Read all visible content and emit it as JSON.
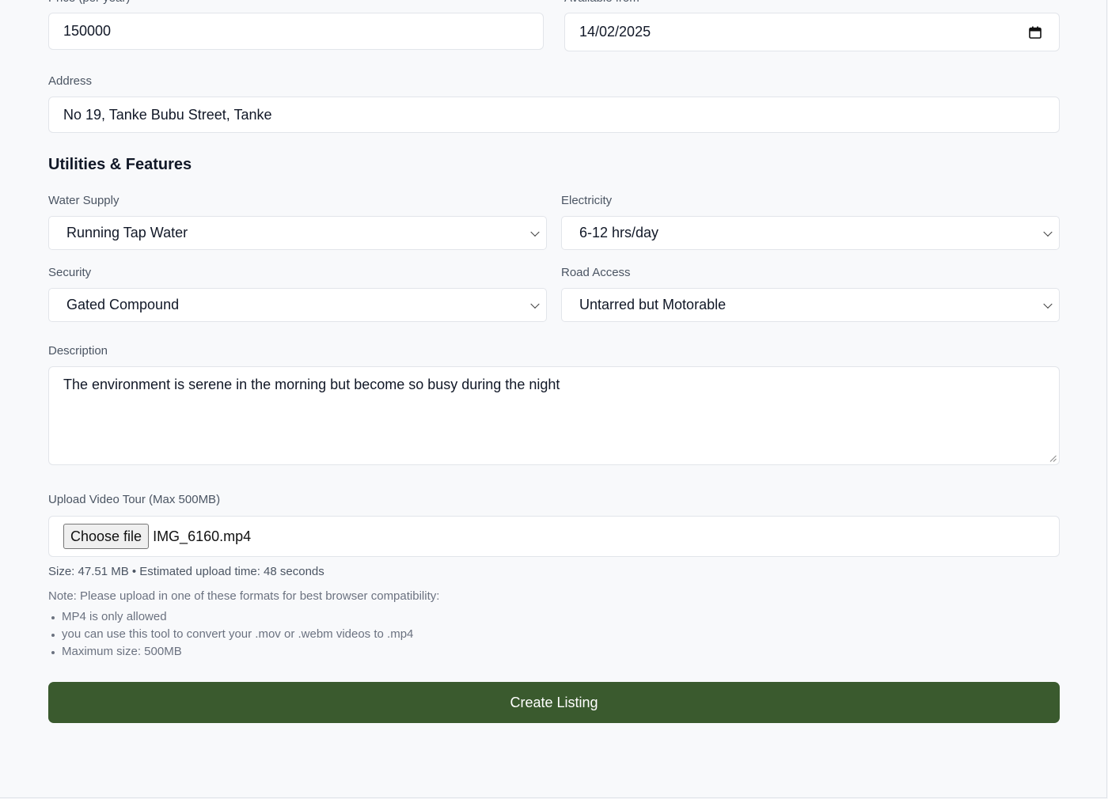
{
  "form": {
    "price": {
      "label": "Price (per year)",
      "value": "150000"
    },
    "available_from": {
      "label": "Available from",
      "value": "14/02/2025",
      "icon": "calendar-icon"
    },
    "address": {
      "label": "Address",
      "value": "No 19, Tanke Bubu Street, Tanke"
    },
    "utilities_section": {
      "title": "Utilities & Features"
    },
    "water_supply": {
      "label": "Water Supply",
      "selected": "Running Tap Water"
    },
    "electricity": {
      "label": "Electricity",
      "selected": "6-12 hrs/day"
    },
    "security": {
      "label": "Security",
      "selected": "Gated Compound"
    },
    "road_access": {
      "label": "Road Access",
      "selected": "Untarred but Motorable"
    },
    "description": {
      "label": "Description",
      "value": "The environment is serene in the morning but become so busy during the night"
    },
    "video_upload": {
      "label": "Upload Video Tour (Max 500MB)",
      "button_label": "Choose file",
      "file_name": "IMG_6160.mp4",
      "size_info": "Size: 47.51 MB • Estimated upload time: 48 seconds",
      "note": "Note: Please upload in one of these formats for best browser compatibility:",
      "note_items": [
        "MP4 is only allowed",
        "you can use this tool to convert your .mov or .webm videos to .mp4",
        "Maximum size: 500MB"
      ]
    },
    "submit_label": "Create Listing"
  },
  "colors": {
    "background": "#f8f9fb",
    "primary_button": "#3a5a2e",
    "field_border": "#e2e5ea"
  }
}
